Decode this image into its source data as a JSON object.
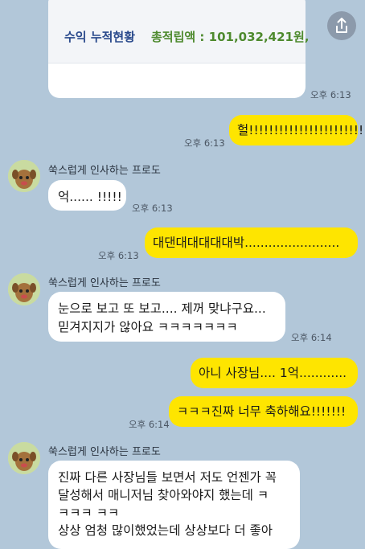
{
  "card": {
    "label": "수익 누적현황",
    "total": "총적립액 : 101,032,421원,"
  },
  "messages": {
    "m1": {
      "time": "오후 6:13"
    },
    "m2": {
      "text": "헐!!!!!!!!!!!!!!!!!!!!!!!!",
      "time": "오후 6:13"
    },
    "m3": {
      "sender": "쑥스럽게 인사하는 프로도",
      "text": "억...... !!!!!",
      "time": "오후 6:13"
    },
    "m4": {
      "text": "대댄대대대대대박........................",
      "time": "오후 6:13"
    },
    "m5": {
      "sender": "쑥스럽게 인사하는 프로도",
      "line1": "눈으로 보고 또 보고.... 제꺼 맞냐구요...",
      "line2": "믿겨지지가 않아요 ㅋㅋㅋㅋㅋㅋㅋ",
      "time": "오후 6:14"
    },
    "m6": {
      "text": "아니 사장님.... 1억............"
    },
    "m7": {
      "text": "ㅋㅋㅋ진짜 너무 축하해요!!!!!!!",
      "time": "오후 6:14"
    },
    "m8": {
      "sender": "쑥스럽게 인사하는 프로도",
      "line1": "진짜 다른 사장님들 보면서 저도 언젠가 꼭",
      "line2": "달성해서 매니저님 찾아와야지 했는데 ㅋ",
      "line3": "ㅋㅋㅋ ㅋㅋ",
      "line4": "상상 엄청 많이했었는데 상상보다 더 좋아"
    }
  },
  "icons": {
    "share": "share-icon",
    "avatar": "frodo-avatar"
  },
  "colors": {
    "background": "#b2c7d9",
    "my_bubble": "#fee500",
    "other_bubble": "#ffffff"
  }
}
